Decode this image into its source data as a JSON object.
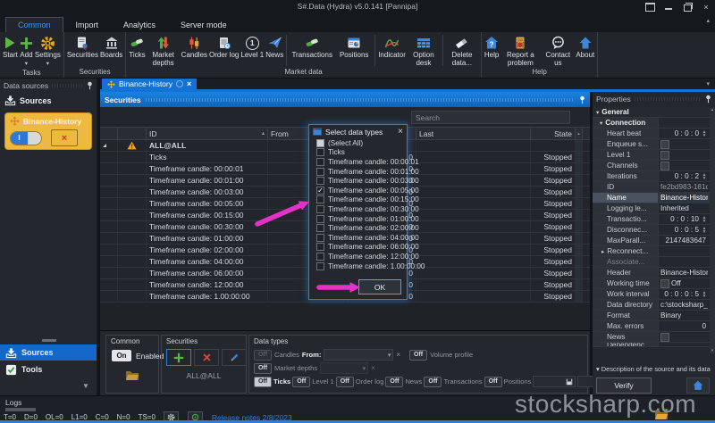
{
  "window": {
    "title": "S#.Data (Hydra) v5.0.141 [Pannipa]"
  },
  "ribbon": {
    "tabs": [
      {
        "label": "Common",
        "active": true
      },
      {
        "label": "Import"
      },
      {
        "label": "Analytics"
      },
      {
        "label": "Server mode"
      }
    ],
    "buttons": {
      "start": "Start",
      "add": "Add",
      "settings": "Settings",
      "securities": "Securities",
      "boards": "Boards",
      "ticks": "Ticks",
      "market_depths": "Market depths",
      "candles": "Candles",
      "order_log": "Order log",
      "level1": "Level 1",
      "news": "News",
      "transactions": "Transactions",
      "positions": "Positions",
      "indicator": "Indicator",
      "option_desk": "Option desk",
      "delete_data": "Delete data...",
      "help": "Help",
      "report": "Report a problem",
      "contact": "Contact us",
      "about": "About"
    },
    "group_labels": {
      "tasks": "Tasks",
      "securities": "Securities",
      "market_data": "Market data",
      "help": "Help"
    }
  },
  "sidebar": {
    "header": "Data sources",
    "sources_label": "Sources",
    "card": {
      "title": "Binance-History"
    },
    "nav_sources": "Sources",
    "nav_tools": "Tools"
  },
  "doc_tab": {
    "label": "Binance-History"
  },
  "securities_panel": {
    "title": "Securities",
    "search_placeholder": "Search",
    "columns": {
      "id": "ID",
      "from": "From",
      "last": "Last",
      "state": "State"
    },
    "rows": [
      {
        "id": "ALL@ALL",
        "type": "parent",
        "count": "",
        "state": ""
      },
      {
        "id": "Ticks",
        "count": "0",
        "state": "Stopped"
      },
      {
        "id": "Timeframe candle: 00:00:01",
        "count": "0",
        "state": "Stopped"
      },
      {
        "id": "Timeframe candle: 00:01:00",
        "count": "0",
        "state": "Stopped"
      },
      {
        "id": "Timeframe candle: 00:03:00",
        "count": "0",
        "state": "Stopped"
      },
      {
        "id": "Timeframe candle: 00:05:00",
        "count": "0",
        "state": "Stopped"
      },
      {
        "id": "Timeframe candle: 00:15:00",
        "count": "0",
        "state": "Stopped"
      },
      {
        "id": "Timeframe candle: 00:30:00",
        "count": "0",
        "state": "Stopped"
      },
      {
        "id": "Timeframe candle: 01:00:00",
        "count": "0",
        "state": "Stopped"
      },
      {
        "id": "Timeframe candle: 02:00:00",
        "count": "0",
        "state": "Stopped"
      },
      {
        "id": "Timeframe candle: 04:00:00",
        "count": "0",
        "state": "Stopped"
      },
      {
        "id": "Timeframe candle: 06:00:00",
        "count": "0",
        "state": "Stopped"
      },
      {
        "id": "Timeframe candle: 12:00:00",
        "count": "0",
        "state": "Stopped"
      },
      {
        "id": "Timeframe candle: 1.00:00:00",
        "count": "0",
        "state": "Stopped"
      }
    ]
  },
  "dialog": {
    "title": "Select data types",
    "ok_label": "OK",
    "items": [
      {
        "label": "(Select All)",
        "box": "solid"
      },
      {
        "label": "Ticks",
        "box": "empty"
      },
      {
        "label": "Timeframe candle: 00:00:01",
        "box": "empty"
      },
      {
        "label": "Timeframe candle: 00:01:00",
        "box": "empty"
      },
      {
        "label": "Timeframe candle: 00:03:00",
        "box": "empty"
      },
      {
        "label": "Timeframe candle: 00:05:00",
        "box": "check"
      },
      {
        "label": "Timeframe candle: 00:15:00",
        "box": "empty"
      },
      {
        "label": "Timeframe candle: 00:30:00",
        "box": "empty"
      },
      {
        "label": "Timeframe candle: 01:00:00",
        "box": "empty"
      },
      {
        "label": "Timeframe candle: 02:00:00",
        "box": "empty"
      },
      {
        "label": "Timeframe candle: 04:00:00",
        "box": "empty"
      },
      {
        "label": "Timeframe candle: 06:00:00",
        "box": "empty"
      },
      {
        "label": "Timeframe candle: 12:00:00",
        "box": "empty"
      },
      {
        "label": "Timeframe candle: 1.00:00:00",
        "box": "empty"
      }
    ]
  },
  "properties": {
    "title": "Properties",
    "rows": [
      {
        "label": "General",
        "type": "group"
      },
      {
        "label": "Connection",
        "type": "group2"
      },
      {
        "label": "Heart beat",
        "value": "0 : 0 : 0",
        "type": "spin"
      },
      {
        "label": "Enqueue s...",
        "type": "check"
      },
      {
        "label": "Level 1",
        "type": "check"
      },
      {
        "label": "Channels",
        "type": "check"
      },
      {
        "label": "Iterations",
        "value": "0 : 0 : 2",
        "type": "spin"
      },
      {
        "label": "ID",
        "value": "fe2bd983-181d-...",
        "type": "dim"
      },
      {
        "label": "Name",
        "value": "Binance-History",
        "type": "text",
        "selected": true
      },
      {
        "label": "Logging le...",
        "value": "Inherited",
        "type": "text"
      },
      {
        "label": "Transactio...",
        "value": "0 : 0 : 10",
        "type": "spin"
      },
      {
        "label": "Disconnec...",
        "value": "0 : 0 : 5",
        "type": "spin"
      },
      {
        "label": "MaxParall...",
        "value": "2147483647",
        "type": "num"
      },
      {
        "label": "Reconnect...",
        "type": "collapsed"
      },
      {
        "label": "Associate...",
        "type": "dimlabel"
      },
      {
        "label": "Header",
        "value": "Binance-History",
        "type": "text"
      },
      {
        "label": "Working time",
        "value": "Off",
        "type": "checktext"
      },
      {
        "label": "Work interval",
        "value": "0 : 0 : 0 : 5",
        "type": "spin"
      },
      {
        "label": "Data directory",
        "value": "c:\\stocksharp_ins...",
        "type": "text"
      },
      {
        "label": "Format",
        "value": "Binary",
        "type": "text"
      },
      {
        "label": "Max. errors",
        "value": "0",
        "type": "num"
      },
      {
        "label": "News",
        "type": "check"
      },
      {
        "label": "Dependenc...",
        "type": "cut"
      }
    ],
    "description_label": "Description of the source and its data",
    "verify_label": "Verify"
  },
  "bottom": {
    "common": {
      "title": "Common",
      "on_label": "On",
      "enabled_label": "Enabled"
    },
    "securities": {
      "title": "Securities",
      "all_label": "ALL@ALL"
    },
    "data_types": {
      "title": "Data types",
      "off": "Off",
      "candles": "Candles",
      "from": "From:",
      "volume_profile": "Volume profile",
      "market_depths": "Market depths",
      "ticks": "Ticks",
      "level1": "Level 1",
      "order_log": "Order log",
      "news": "News",
      "transactions": "Transactions",
      "positions": "Positions"
    }
  },
  "statusbar": {
    "logs_label": "Logs",
    "counters": [
      "T=0",
      "D=0",
      "OL=0",
      "L1=0",
      "C=0",
      "N=0",
      "TS=0"
    ],
    "release_link": "Release notes 2/8/2023"
  },
  "watermark": {
    "text": "stocksharp.com"
  },
  "colors": {
    "accent_blue": "#1373d4",
    "binance_yellow": "#eeb93f",
    "arrow_magenta": "#e531c9",
    "stopped_text": "#d6dade",
    "green": "#5cb546",
    "orange": "#f0a224"
  }
}
